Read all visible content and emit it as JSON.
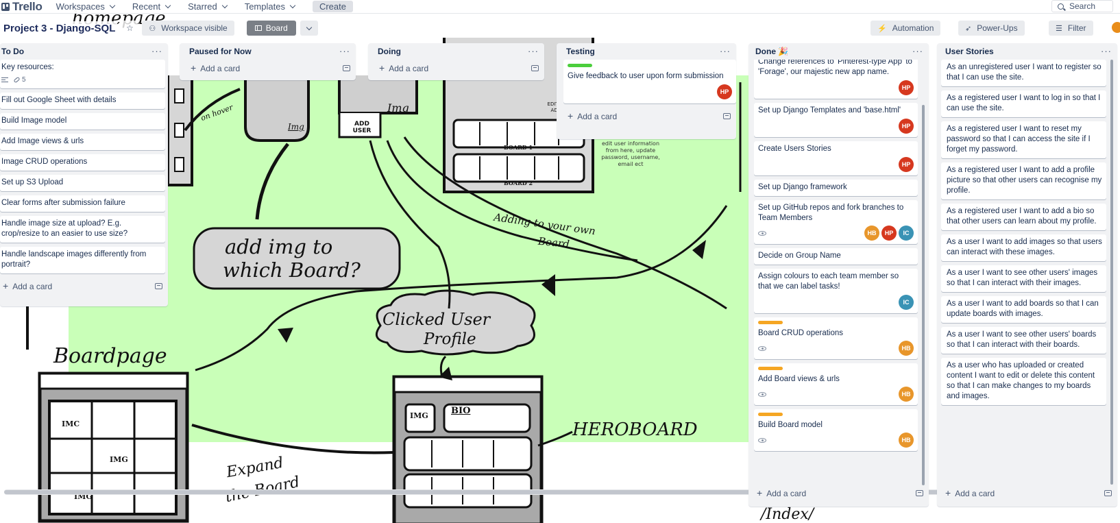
{
  "topbar": {
    "logo": "Trello",
    "nav": [
      "Workspaces",
      "Recent",
      "Starred",
      "Templates"
    ],
    "create": "Create",
    "search": "Search"
  },
  "board": {
    "title": "Project 3 - Django-SQL",
    "visibility": "Workspace visible",
    "view": "Board",
    "automation": "Automation",
    "powerups": "Power-Ups",
    "filter": "Filter"
  },
  "colors": {
    "hp": "#d6381f",
    "hb": "#e8962b",
    "ic": "#3a93b5",
    "green_label": "#4bce3c",
    "orange_label": "#f5a623",
    "sketch_green": "#c9ffb8"
  },
  "lists": {
    "todo": {
      "title": "To Do",
      "cards": [
        "Key resources:",
        "Fill out Google Sheet with details",
        "Build Image model",
        "Add Image views & urls",
        "Image CRUD operations",
        "Set up S3 Upload",
        "Clear forms after submission failure",
        "Handle image size at upload? E.g. crop/resize to an easier to use size?",
        "Handle landscape images differently from portrait?"
      ],
      "attachments": "5",
      "add": "Add a card"
    },
    "paused": {
      "title": "Paused for Now",
      "add": "Add a card"
    },
    "doing": {
      "title": "Doing",
      "add": "Add a card"
    },
    "testing": {
      "title": "Testing",
      "cards": [
        "Give feedback to user upon form submission"
      ],
      "add": "Add a card"
    },
    "done": {
      "title": "Done 🎉",
      "cards": [
        "Change references to 'Pinterest-type App' to 'Forage', our majestic new app name.",
        "Set up Django Templates and 'base.html'",
        "Create Users Stories",
        "Set up Django framework",
        "Set up GitHub repos and fork branches to Team Members",
        "Decide on Group Name",
        "Assign colours to each team member so that we can label tasks!",
        "Board CRUD operations",
        "Add Board views & urls",
        "Build Board model"
      ],
      "add": "Add a card"
    },
    "stories": {
      "title": "User Stories",
      "cards": [
        "As an unregistered user I want to register so that I can use the site.",
        "As a registered user I want to log in so that I can use the site.",
        "As a registered user I want to reset my password so that I can access the site if I forget my password.",
        "As a registered user I want to add a profile picture so that other users can recognise my profile.",
        "As a registered user I want to add a bio so that other users can learn about my profile.",
        "As a user I want to add images so that users can interact with these images.",
        "As a user I want to see other users' images so that I can interact with their images.",
        "As a user I want to add boards so that I can update boards with images.",
        "As a user I want to see other users' boards so that I can interact with their boards.",
        "As a user who has uploaded or created content I want to edit or delete this content so that I can make changes to my boards and images."
      ],
      "add": "Add a card"
    }
  },
  "avatars": {
    "hp": "HP",
    "hb": "HB",
    "ic": "IC"
  },
  "sketch": {
    "homepage": "homepage",
    "add_img": [
      "add img to",
      "which Board?"
    ],
    "adding": [
      "Adding to your own",
      "Board"
    ],
    "clicked": [
      "Clicked User",
      "Profile"
    ],
    "boardpage": "Boardpage",
    "expand": [
      "Expand",
      "the Board"
    ],
    "heroboard": "HEROBOARD",
    "index": "/Index/",
    "img": "Img",
    "img_caps": "IMG",
    "img_lower": "img",
    "imc": "IMC",
    "add_user": [
      "ADD",
      "USER"
    ],
    "bio": "BIO",
    "board1": "BOARD 1",
    "board2": "BOARD 2",
    "on_hover": "on hover",
    "edit_account": [
      "EDIT ACCOUNT",
      "ADD BOARD"
    ],
    "edit_note": "edit user information from here, update password, username, email ect"
  }
}
